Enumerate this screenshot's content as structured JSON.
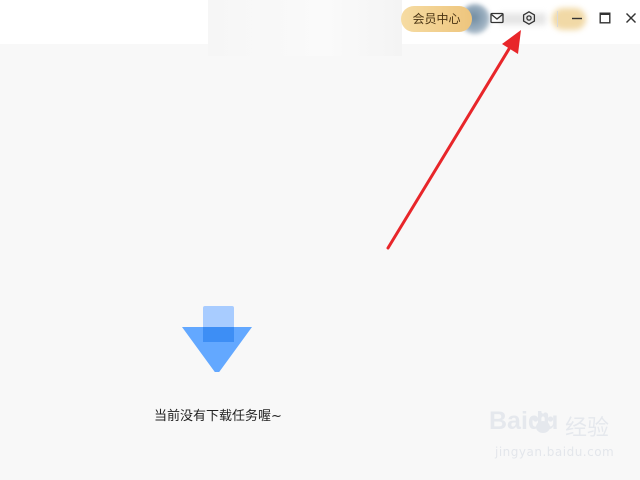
{
  "titlebar": {
    "vip_label": "会员中心",
    "icons": {
      "mail": "mail-icon",
      "settings": "settings-icon",
      "minimize": "minimize-icon",
      "maximize": "maximize-icon",
      "close": "close-icon"
    }
  },
  "main": {
    "empty_text": "当前没有下载任务喔~",
    "empty_icon": "download-arrow-icon"
  },
  "watermark": {
    "logo": "Bai",
    "logo_paw": "du",
    "cn": "经验",
    "sub": "jingyan.baidu.com"
  },
  "colors": {
    "vip_gradient_start": "#f6dca3",
    "vip_gradient_end": "#eec57d",
    "download_blue": "#5aa4ff",
    "annotation_red": "#e8262a"
  }
}
